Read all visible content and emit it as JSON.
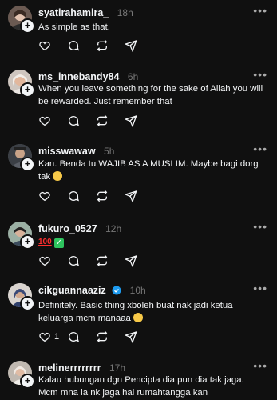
{
  "posts": [
    {
      "username": "syatirahamira_",
      "time": "18h",
      "text": "As simple as that.",
      "likes": ""
    },
    {
      "username": "ms_innebandy84",
      "time": "6h",
      "text": "When you leave something for the sake of Allah you will be rewarded. Just remember that",
      "likes": ""
    },
    {
      "username": "misswawaw",
      "time": "5h",
      "text": "Kan. Benda tu WAJIB AS A MUSLIM. Maybe bagi dorg tak",
      "likes": ""
    },
    {
      "username": "fukuro_0527",
      "time": "12h",
      "text": "",
      "likes": ""
    },
    {
      "username": "cikguannaaziz",
      "time": "10h",
      "verified": true,
      "text": "Definitely. Basic thing xboleh buat nak jadi ketua keluarga mcm manaaa",
      "likes": "1"
    },
    {
      "username": "melinerrrrrrrr",
      "time": "17h",
      "text": "Kalau hubungan dgn Pencipta dia pun dia tak jaga. Mcm mna la nk jaga hal rumahtangga kan",
      "likes": ""
    }
  ],
  "emoji_100": "100",
  "icons": {
    "like": "heart-icon",
    "reply": "comment-icon",
    "repost": "repost-icon",
    "share": "send-icon",
    "more": "more-icon",
    "follow": "plus-icon"
  },
  "colors": {
    "background": "#101010",
    "text": "#f3f5f7",
    "muted": "#777777",
    "verified": "#1d9bf0"
  }
}
